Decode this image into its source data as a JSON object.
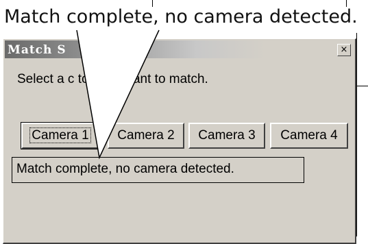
{
  "callout_text": "Match complete, no camera detected.",
  "dialog": {
    "title": "Match S",
    "close_glyph": "×",
    "instruction": "Select a c         tch you want to match.",
    "buttons": [
      "Camera 1",
      "Camera 2",
      "Camera 3",
      "Camera 4"
    ],
    "status": "Match complete, no camera detected."
  }
}
